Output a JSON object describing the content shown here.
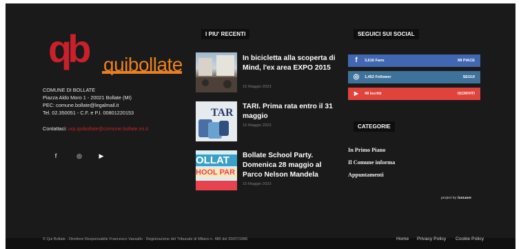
{
  "brand": {
    "logo_qb": "qb",
    "logo_text": "quibollate",
    "primary_color": "#c9212b",
    "accent_color": "#e8801f"
  },
  "about": {
    "name": "COMUNE DI BOLLATE",
    "address": "Piazza Aldo Moro 1 - 20021 Bollate (MI)",
    "pec": "PEC: comune.bollate@legalmail.it",
    "tel": "Tel. 02.350051 - C.F. e P.I. 00801220153",
    "contacts_label": "Contattaci:",
    "contacts_email": "urp.quibollate@comune.bollate.mi.it",
    "social_icons": [
      "facebook-icon",
      "instagram-icon",
      "youtube-icon"
    ],
    "social_glyphs": [
      "f",
      "◎",
      "▶"
    ]
  },
  "recent": {
    "heading": "I PIU' RECENTI",
    "articles": [
      {
        "title": "In bicicletta alla scoperta di Mind, l'ex area EXPO 2015",
        "date": "15 Maggio 2023"
      },
      {
        "title": "TARI. Prima rata entro il 31 maggio",
        "date": "15 Maggio 2023",
        "thumb_text": "TAR"
      },
      {
        "title": "Bollate School Party. Domenica 28 maggio al Parco Nelson Mandela",
        "date": "15 Maggio 2023",
        "thumb_line1": "OLLAT",
        "thumb_line2": "HOOL PAR"
      }
    ]
  },
  "social": {
    "heading": "SEGUICI SUI SOCIAL",
    "buttons": [
      {
        "icon": "facebook-icon",
        "glyph": "f",
        "count": "3,616",
        "unit": "Fans",
        "action": "MI PIACE",
        "color": "#4267b2"
      },
      {
        "icon": "instagram-icon",
        "glyph": "◎",
        "count": "1,452",
        "unit": "Follower",
        "action": "SEGUI",
        "color": "#3f729b"
      },
      {
        "icon": "youtube-icon",
        "glyph": "▶",
        "count": "49",
        "unit": "Iscritti",
        "action": "ISCRIVITI",
        "color": "#e0433b"
      }
    ]
  },
  "categories": {
    "heading": "CATEGORIE",
    "items": [
      "In Primo Piano",
      "Il Comune informa",
      "Appuntamenti"
    ]
  },
  "credit": {
    "prefix": "project by",
    "name": "fantanet"
  },
  "footer": {
    "copyright": "© Qui Bollate - Direttore Responsabile Francesco Vassallo - Registrazione del Tribunale di Milano n. 480 del 20/07/1996",
    "links": [
      "Home",
      "Privacy Policy",
      "Cookie Policy"
    ]
  }
}
